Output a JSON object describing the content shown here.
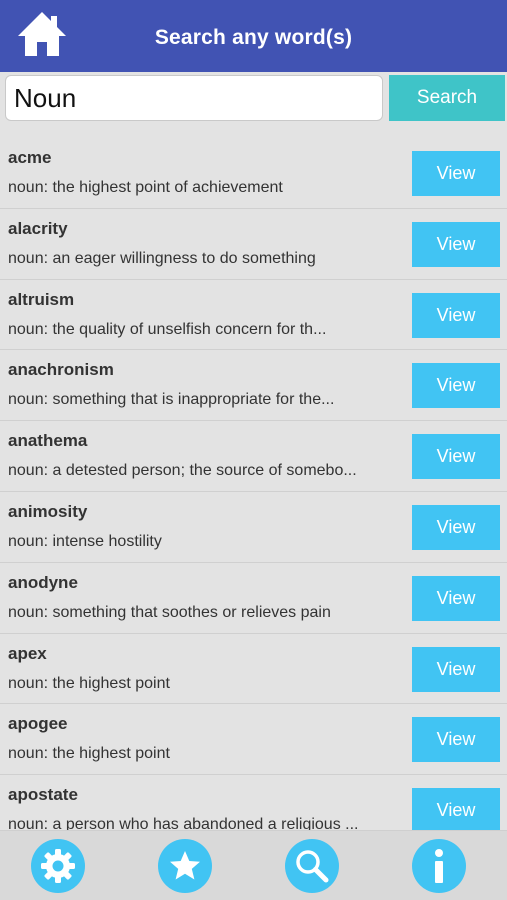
{
  "header": {
    "title": "Search any word(s)"
  },
  "search": {
    "value": "Noun",
    "button_label": "Search"
  },
  "results": [
    {
      "word": "acme",
      "definition": "noun: the highest point of achievement",
      "button": "View"
    },
    {
      "word": "alacrity",
      "definition": "noun: an eager willingness to do something",
      "button": "View"
    },
    {
      "word": "altruism",
      "definition": "noun: the quality of unselfish concern for th...",
      "button": "View"
    },
    {
      "word": "anachronism",
      "definition": "noun: something that is inappropriate for the...",
      "button": "View"
    },
    {
      "word": "anathema",
      "definition": "noun: a detested person; the source of somebo...",
      "button": "View"
    },
    {
      "word": "animosity",
      "definition": "noun: intense hostility",
      "button": "View"
    },
    {
      "word": "anodyne",
      "definition": "noun: something that soothes or relieves pain",
      "button": "View"
    },
    {
      "word": "apex",
      "definition": "noun: the highest point",
      "button": "View"
    },
    {
      "word": "apogee",
      "definition": "noun: the highest point",
      "button": "View"
    },
    {
      "word": "apostate",
      "definition": "noun: a person who has abandoned a religious ...",
      "button": "View"
    }
  ],
  "tabbar": {
    "icons": [
      "gear-icon",
      "star-icon",
      "search-icon",
      "info-icon"
    ]
  },
  "colors": {
    "header": "#4153b3",
    "search_button": "#3fc4c8",
    "view_button": "#41c4f3",
    "background": "#e3e3e3"
  }
}
